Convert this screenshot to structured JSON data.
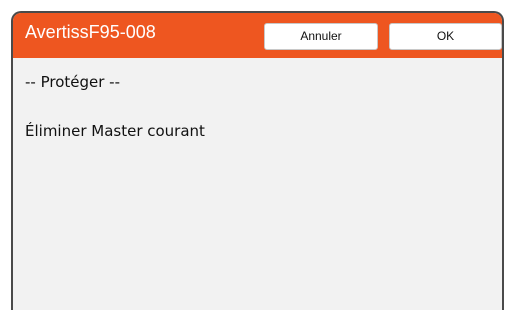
{
  "dialog": {
    "title": "AvertissF95-008",
    "cancel_label": "Annuler",
    "ok_label": "OK",
    "message_lines": [
      "-- Protéger --",
      "Éliminer Master courant"
    ]
  },
  "colors": {
    "title_bar": "#ee5620",
    "dialog_background": "#f2f2f2",
    "button_background": "#ffffff",
    "frame_border": "#4a4a4a"
  }
}
